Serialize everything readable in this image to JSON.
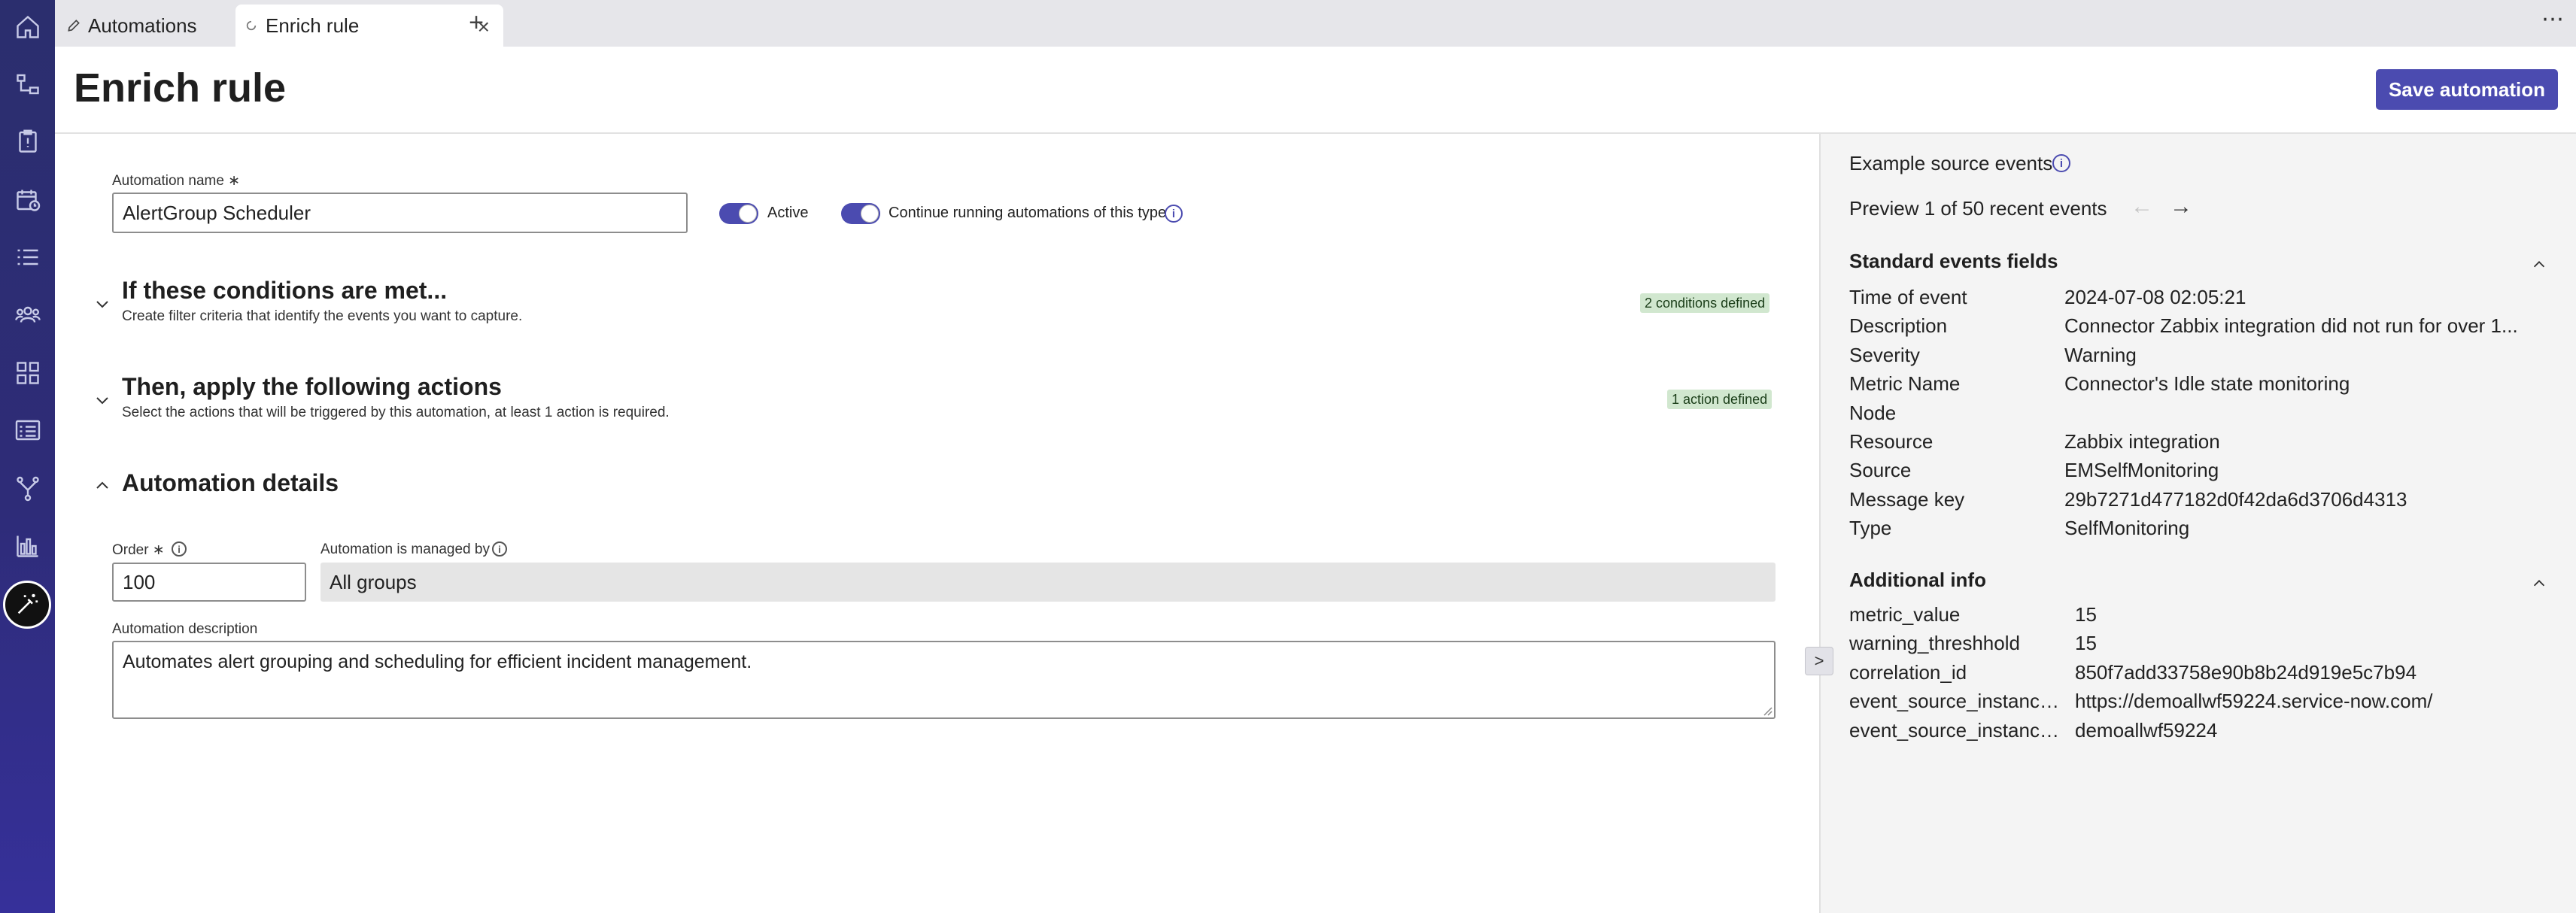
{
  "nav": {
    "items": [
      "home-icon",
      "workflow-icon",
      "clipboard-icon",
      "calendar-icon",
      "list-icon",
      "users-icon",
      "grid-icon",
      "table-list-icon",
      "branch-icon",
      "bar-chart-icon"
    ],
    "active": "magic-wand-icon"
  },
  "tabs": [
    {
      "label": "Automations",
      "icon": "pencil-icon"
    },
    {
      "label": "Enrich rule",
      "icon": "loading-icon",
      "close": "×"
    }
  ],
  "tab_add": "+",
  "more_menu": "⋯",
  "header": {
    "title": "Enrich rule",
    "save_label": "Save automation"
  },
  "form": {
    "name_label": "Automation name",
    "required_mark": "∗",
    "name_value": "AlertGroup Scheduler",
    "active_label": "Active",
    "continue_label": "Continue running automations of this type",
    "info_glyph": "i"
  },
  "sections": {
    "conditions": {
      "title": "If these conditions are met...",
      "subtitle": "Create filter criteria that identify the events you want to capture.",
      "badge": "2 conditions defined"
    },
    "actions": {
      "title": "Then, apply the following actions",
      "subtitle": "Select the actions that will be triggered by this automation, at least 1 action is required.",
      "badge": "1 action defined"
    },
    "details": {
      "title": "Automation details",
      "order_label": "Order",
      "order_value": "100",
      "managed_label": "Automation is managed by",
      "managed_value": "All groups",
      "description_label": "Automation description",
      "description_value": "Automates alert grouping and scheduling for efficient incident management."
    }
  },
  "preview": {
    "title": "Example source events",
    "counter": "Preview 1 of 50 recent events",
    "prev": "←",
    "next": "→",
    "collapse": ">",
    "standard_title": "Standard events fields",
    "standard_fields": [
      {
        "key": "Time of event",
        "value": "2024-07-08 02:05:21"
      },
      {
        "key": "Description",
        "value": "Connector Zabbix integration did not run for over 1..."
      },
      {
        "key": "Severity",
        "value": "Warning"
      },
      {
        "key": "Metric Name",
        "value": "Connector's Idle state monitoring"
      },
      {
        "key": "Node",
        "value": ""
      },
      {
        "key": "Resource",
        "value": "Zabbix integration"
      },
      {
        "key": "Source",
        "value": "EMSelfMonitoring"
      },
      {
        "key": "Message key",
        "value": "29b7271d477182d0f42da6d3706d4313"
      },
      {
        "key": "Type",
        "value": "SelfMonitoring"
      }
    ],
    "additional_title": "Additional info",
    "additional_fields": [
      {
        "key": "metric_value",
        "value": "15"
      },
      {
        "key": "warning_threshhold",
        "value": "15"
      },
      {
        "key": "correlation_id",
        "value": "850f7add33758e90b8b24d919e5c7b94"
      },
      {
        "key": "event_source_instance...",
        "value": "https://demoallwf59224.service-now.com/"
      },
      {
        "key": "event_source_instance...",
        "value": "demoallwf59224"
      }
    ]
  }
}
